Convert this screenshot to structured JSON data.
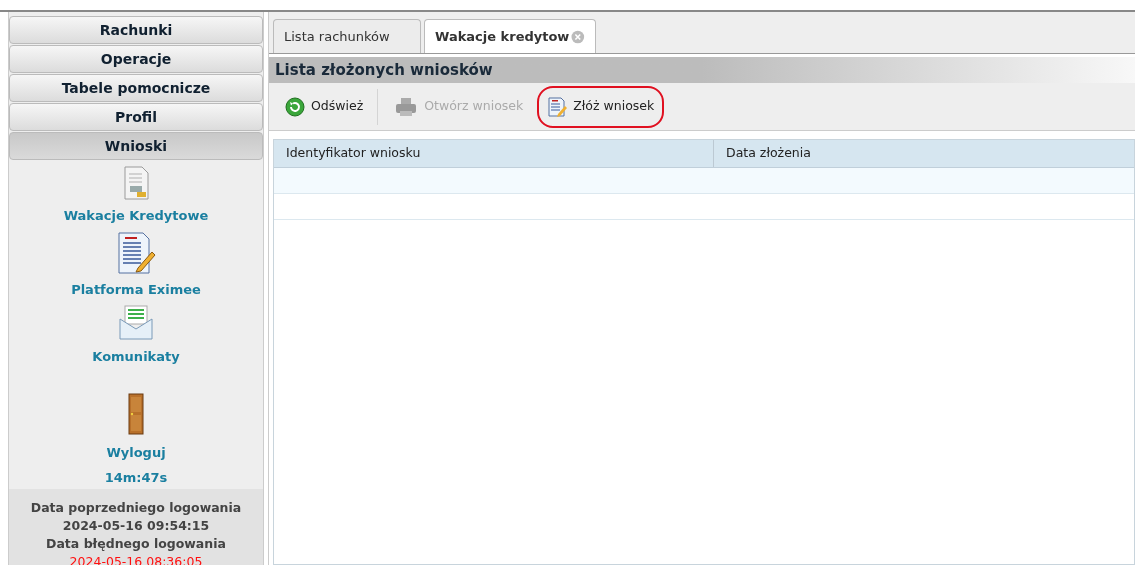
{
  "sidebar": {
    "sections": [
      {
        "label": "Rachunki",
        "selected": false
      },
      {
        "label": "Operacje",
        "selected": false
      },
      {
        "label": "Tabele pomocnicze",
        "selected": false
      },
      {
        "label": "Profil",
        "selected": false
      },
      {
        "label": "Wnioski",
        "selected": true
      }
    ],
    "items": [
      {
        "label": "Wakacje Kredytowe",
        "kind": "loan"
      },
      {
        "label": "Platforma Eximee",
        "kind": "form"
      },
      {
        "label": "Komunikaty",
        "kind": "mail"
      },
      {
        "label": "Wyloguj",
        "kind": "door",
        "timer": "14m:47s"
      }
    ],
    "login_info": [
      {
        "text": "Data poprzedniego logowania",
        "kind": "label"
      },
      {
        "text": "2024-05-16 09:54:15",
        "kind": "value"
      },
      {
        "text": "Data błędnego logowania",
        "kind": "label"
      },
      {
        "text": "2024-05-16 08:36:05",
        "kind": "error"
      }
    ]
  },
  "tabs": [
    {
      "label": "Lista rachunków",
      "selected": false,
      "closable": false
    },
    {
      "label": "Wakacje kredytow",
      "selected": true,
      "closable": true
    }
  ],
  "panel": {
    "title": "Lista złożonych wniosków",
    "toolbar": [
      {
        "label": "Odśwież",
        "kind": "refresh",
        "disabled": false,
        "highlighted": false
      },
      {
        "label": "Otwórz wniosek",
        "kind": "open",
        "disabled": true,
        "highlighted": false
      },
      {
        "label": "Złóż wniosek",
        "kind": "submit",
        "disabled": false,
        "highlighted": true
      }
    ],
    "table": {
      "columns": [
        "Identyfikator wniosku",
        "Data złożenia"
      ]
    }
  }
}
